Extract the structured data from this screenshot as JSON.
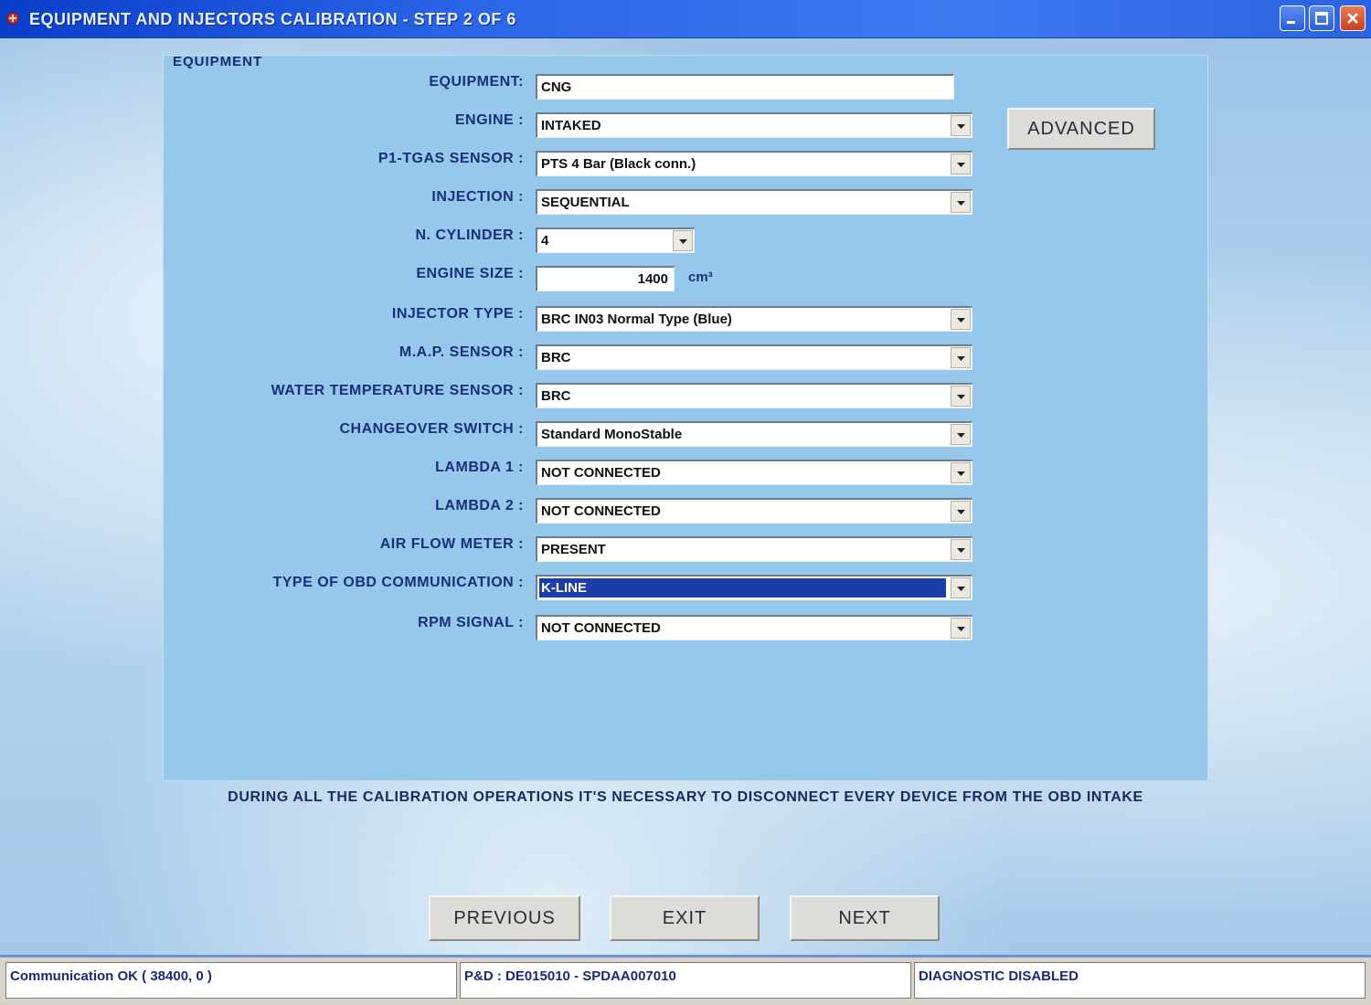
{
  "window": {
    "title": "EQUIPMENT AND INJECTORS CALIBRATION - STEP 2 OF 6"
  },
  "group": {
    "title": "EQUIPMENT"
  },
  "fields": {
    "equipment": {
      "label": "EQUIPMENT:",
      "value": "CNG"
    },
    "engine": {
      "label": "ENGINE :",
      "value": "INTAKED"
    },
    "sensor": {
      "label": "P1-TGAS SENSOR :",
      "value": "PTS 4 Bar (Black conn.)"
    },
    "injection": {
      "label": "INJECTION :",
      "value": "SEQUENTIAL"
    },
    "cylinder": {
      "label": "N. CYLINDER :",
      "value": "4"
    },
    "engine_size": {
      "label": "ENGINE SIZE :",
      "value": "1400",
      "unit": "cm³"
    },
    "injector": {
      "label": "INJECTOR TYPE :",
      "value": "BRC IN03 Normal Type (Blue)"
    },
    "map": {
      "label": "M.A.P. SENSOR :",
      "value": "BRC"
    },
    "water": {
      "label": "WATER TEMPERATURE SENSOR :",
      "value": "BRC"
    },
    "changeover": {
      "label": "CHANGEOVER SWITCH :",
      "value": "Standard MonoStable"
    },
    "lambda1": {
      "label": "LAMBDA 1 :",
      "value": "NOT CONNECTED"
    },
    "lambda2": {
      "label": "LAMBDA 2 :",
      "value": "NOT CONNECTED"
    },
    "airflow": {
      "label": "AIR FLOW METER :",
      "value": "PRESENT"
    },
    "obd": {
      "label": "TYPE OF OBD COMMUNICATION :",
      "value": "K-LINE"
    },
    "rpm": {
      "label": "RPM SIGNAL :",
      "value": "NOT CONNECTED"
    }
  },
  "buttons": {
    "advanced": "ADVANCED",
    "previous": "PREVIOUS",
    "exit": "EXIT",
    "next": "NEXT"
  },
  "notice": "DURING ALL THE CALIBRATION OPERATIONS IT'S NECESSARY TO DISCONNECT EVERY DEVICE FROM THE OBD INTAKE",
  "status": {
    "communication": "Communication OK ( 38400,  0 )",
    "pn": "P&D : DE015010 - SPDAA007010",
    "diagnostic": "DIAGNOSTIC DISABLED"
  },
  "icons": {
    "app": "app-icon",
    "minimize": "minimize-icon",
    "maximize": "maximize-icon",
    "close": "close-icon",
    "dropdown": "chevron-down-icon"
  },
  "colors": {
    "titlebar": "#2b66e8",
    "panel": "#96c8ec",
    "label": "#1a2f7a",
    "selection": "#1c3ea8"
  }
}
